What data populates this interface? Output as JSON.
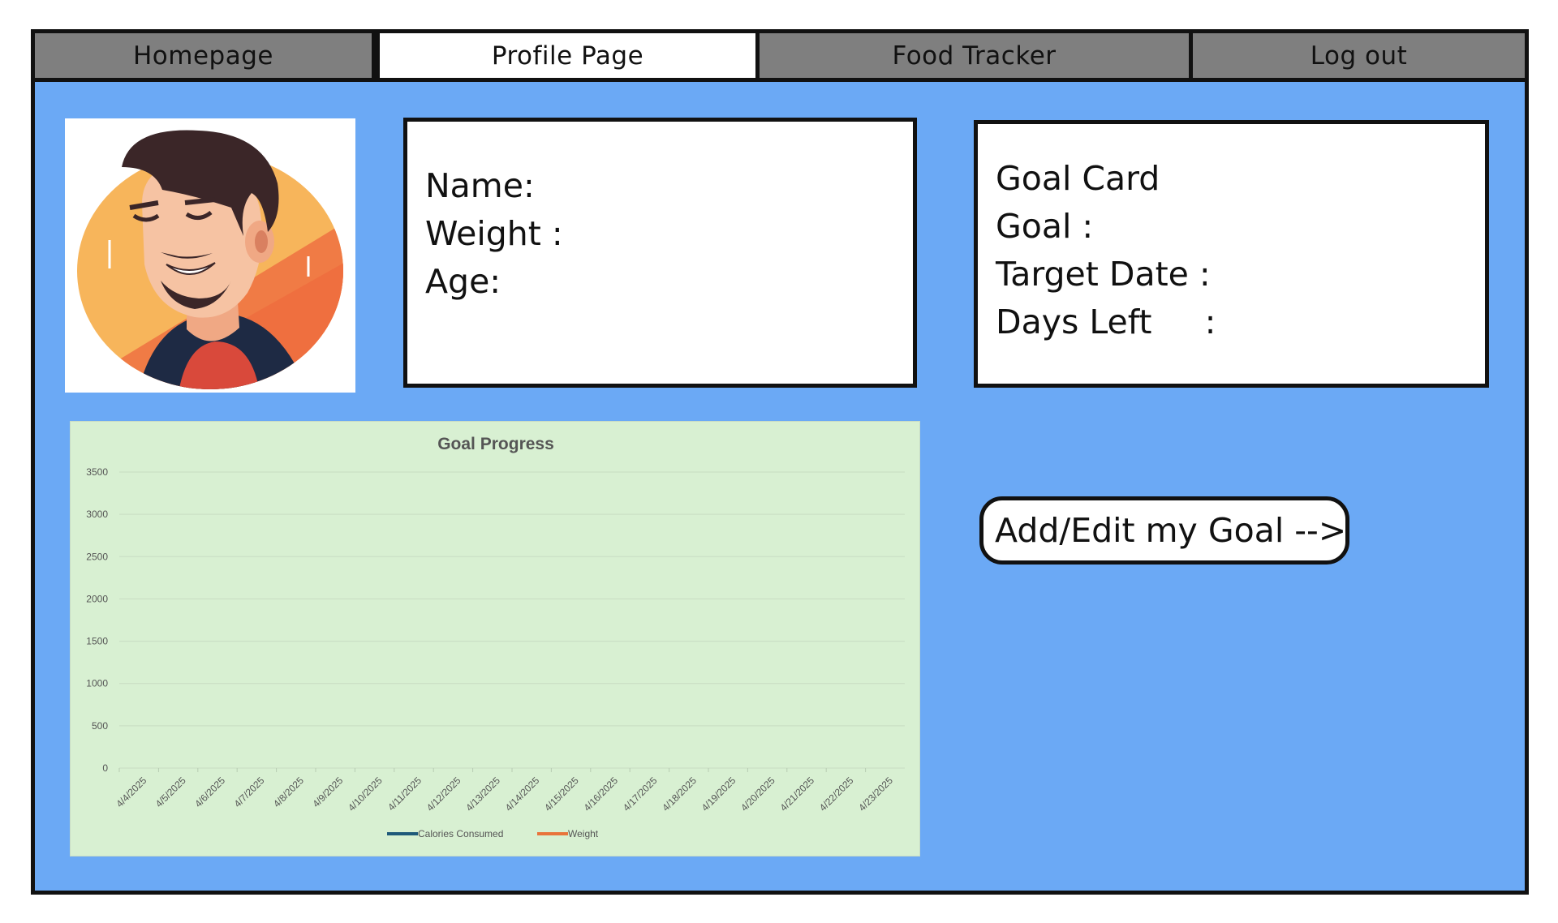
{
  "nav": {
    "tabs": [
      {
        "label": "Homepage"
      },
      {
        "label": "Profile Page"
      },
      {
        "label": "Food Tracker"
      },
      {
        "label": "Log out"
      }
    ],
    "active": "Profile Page"
  },
  "profile": {
    "avatar_icon": "smiling-man-avatar-icon",
    "name_label": "Name:",
    "weight_label": "Weight :",
    "age_label": "Age:"
  },
  "goal_card": {
    "title": "Goal Card",
    "goal_label": "Goal :",
    "target_date_label": "Target Date :",
    "days_left_label": "Days Left     :"
  },
  "add_goal_button": {
    "label": "Add/Edit my Goal -->"
  },
  "colors": {
    "page_bg": "#6ba9f5",
    "tab_bg": "#7f7f7f",
    "chart_bg": "#d8f0d2",
    "series_calories": "#1f5a7a",
    "series_weight": "#e8743b"
  },
  "chart_data": {
    "type": "line",
    "title": "Goal Progress",
    "categories": [
      "4/4/2025",
      "4/5/2025",
      "4/6/2025",
      "4/7/2025",
      "4/8/2025",
      "4/9/2025",
      "4/10/2025",
      "4/11/2025",
      "4/12/2025",
      "4/13/2025",
      "4/14/2025",
      "4/15/2025",
      "4/16/2025",
      "4/17/2025",
      "4/18/2025",
      "4/19/2025",
      "4/20/2025",
      "4/21/2025",
      "4/22/2025",
      "4/23/2025"
    ],
    "y_ticks": [
      "3500",
      "3000",
      "2500",
      "2000",
      "1500",
      "1000",
      "500",
      "0"
    ],
    "ylim": [
      0,
      3500
    ],
    "series": [
      {
        "name": "Calories Consumed",
        "values": []
      },
      {
        "name": "Weight",
        "values": []
      }
    ],
    "grid": true,
    "legend": "bottom"
  }
}
